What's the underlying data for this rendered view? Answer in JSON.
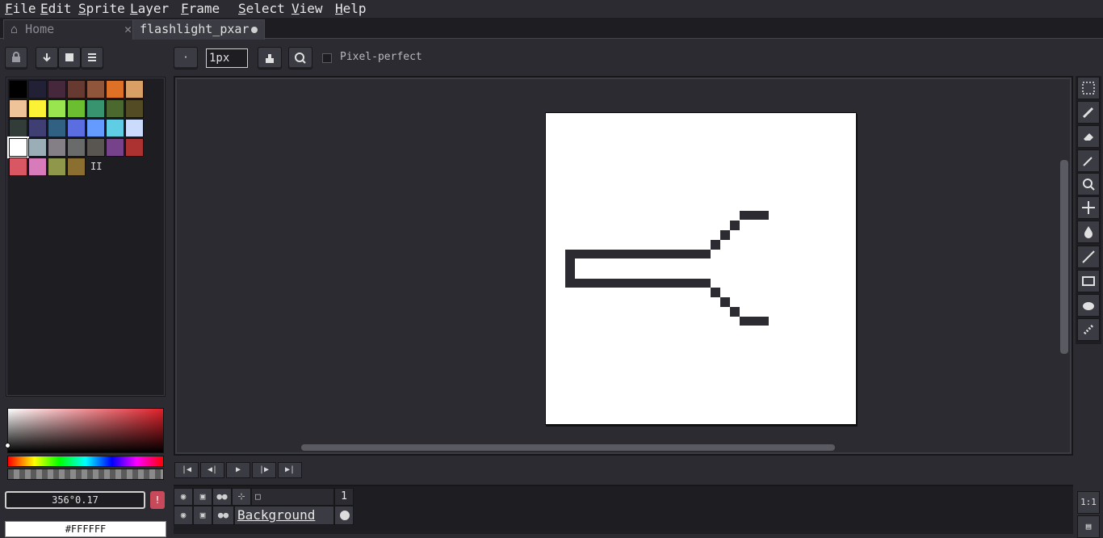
{
  "menubar": {
    "items": [
      {
        "mnemonic": "F",
        "rest": "ile"
      },
      {
        "mnemonic": "E",
        "rest": "dit"
      },
      {
        "mnemonic": "S",
        "rest": "prite"
      },
      {
        "mnemonic": "L",
        "rest": "ayer"
      },
      {
        "mnemonic": "F",
        "rest": "rame"
      },
      {
        "mnemonic": "S",
        "rest": "elect"
      },
      {
        "mnemonic": "V",
        "rest": "iew"
      },
      {
        "mnemonic": "H",
        "rest": "elp"
      }
    ]
  },
  "tabs": {
    "home_label": "Home",
    "home_close": "✕",
    "file_label": "flashlight_pxar"
  },
  "toolbar": {
    "brush_size_value": "1px",
    "pixel_perfect_label": "Pixel-perfect",
    "pixel_perfect_checked": false
  },
  "palette": {
    "colors": [
      "#000000",
      "#222034",
      "#45283c",
      "#663931",
      "#8f563b",
      "#df7126",
      "#d9a066",
      "#eec39a",
      "#fbf236",
      "#99e550",
      "#6abe30",
      "#37946e",
      "#4b692f",
      "#524b24",
      "#323c39",
      "#3f3f74",
      "#306082",
      "#5b6ee1",
      "#639bff",
      "#5fcde4",
      "#cbdbfc",
      "#ffffff",
      "#9badb7",
      "#847e87",
      "#696a6a",
      "#595652",
      "#76428a",
      "#ac3232",
      "#d95763",
      "#d77bba",
      "#8f974a",
      "#8a6f30"
    ],
    "selected_color": "#ffffff",
    "pause_glyph": "II"
  },
  "color_picker": {
    "hsv_text": "356°0.17",
    "warn_glyph": "!",
    "hex_value": "#FFFFFF"
  },
  "timeline": {
    "frame_number": "1",
    "layer_name": "Background"
  },
  "right_bottom": {
    "zoom_label": "1:1"
  }
}
